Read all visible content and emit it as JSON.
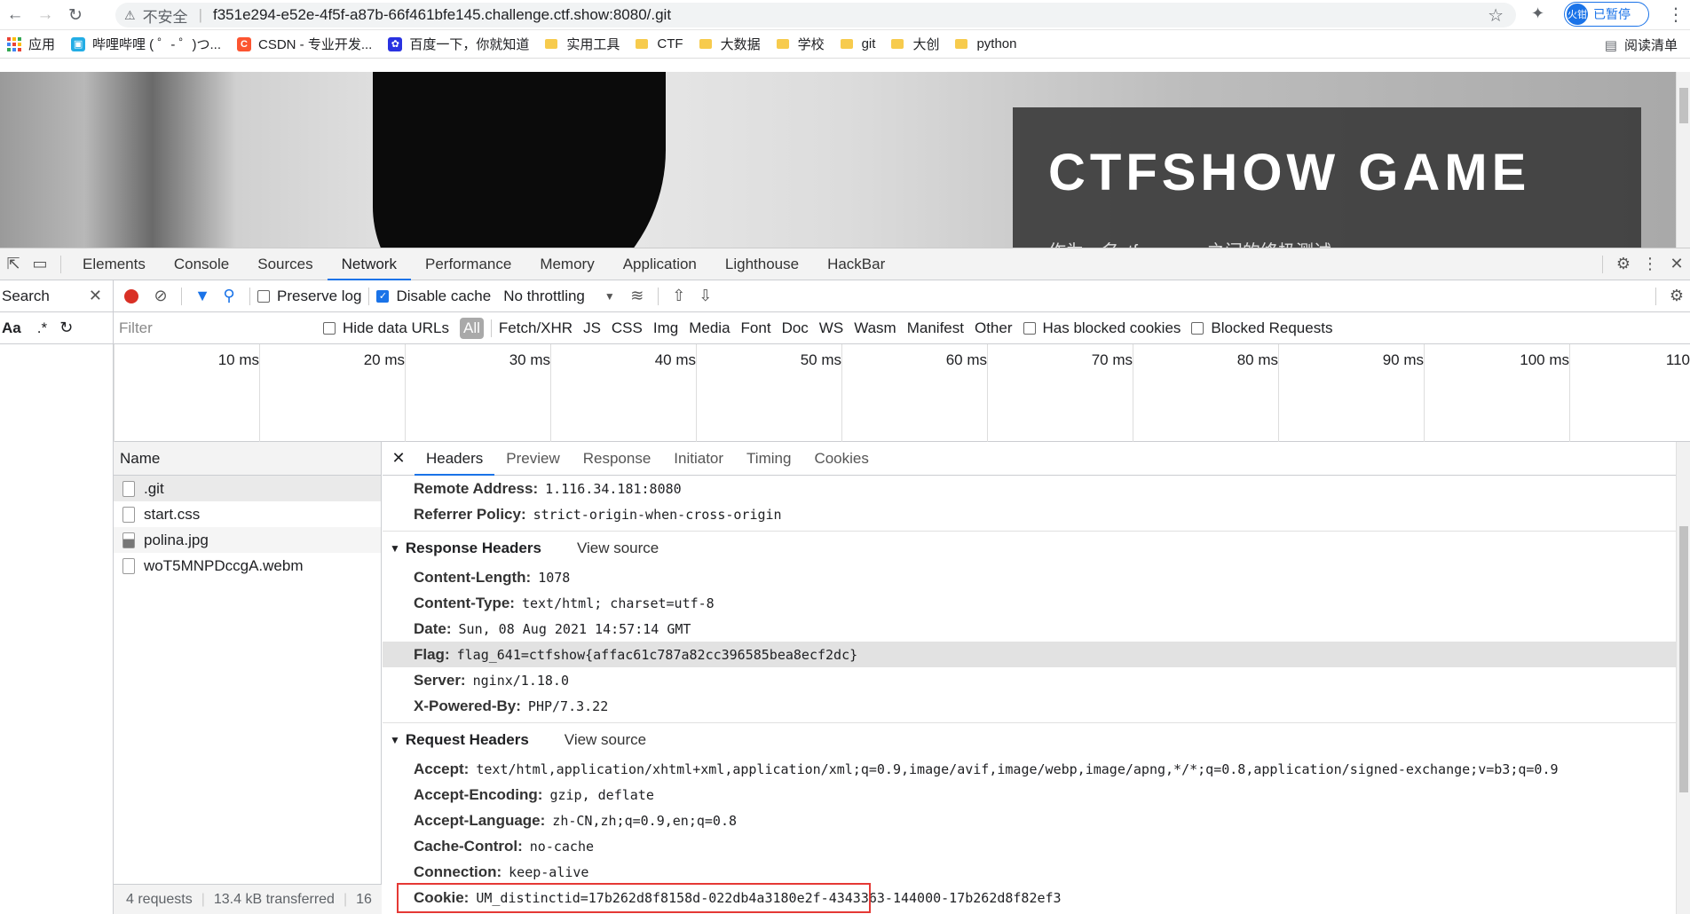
{
  "browser": {
    "security_label": "不安全",
    "url": "f351e294-e52e-4f5f-a87b-66f461bfe145.challenge.ctf.show:8080/.git",
    "profile_avatar": "火钳",
    "profile_status": "已暂停"
  },
  "bookmarks": {
    "apps": "应用",
    "items": [
      "哔哩哔哩 ( ゜- ゜)つ...",
      "CSDN - 专业开发...",
      "百度一下，你就知道",
      "实用工具",
      "CTF",
      "大数据",
      "学校",
      "git",
      "大创",
      "python"
    ],
    "reading_list": "阅读清单"
  },
  "page": {
    "title": "CTFSHOW GAME",
    "subtitle": "作为一名ctfer，……之间的终极测试"
  },
  "devtools": {
    "tabs": [
      "Elements",
      "Console",
      "Sources",
      "Network",
      "Performance",
      "Memory",
      "Application",
      "Lighthouse",
      "HackBar"
    ],
    "active_tab": "Network",
    "search_label": "Search",
    "preserve_log": "Preserve log",
    "disable_cache": "Disable cache",
    "throttling": "No throttling",
    "filter_placeholder": "Filter",
    "hide_data_urls": "Hide data URLs",
    "all_label": "All",
    "filter_types": [
      "Fetch/XHR",
      "JS",
      "CSS",
      "Img",
      "Media",
      "Font",
      "Doc",
      "WS",
      "Wasm",
      "Manifest",
      "Other"
    ],
    "has_blocked_cookies": "Has blocked cookies",
    "blocked_requests": "Blocked Requests",
    "aa_label": "Aa",
    "regex_label": ".*",
    "timeline_ticks": [
      "10 ms",
      "20 ms",
      "30 ms",
      "40 ms",
      "50 ms",
      "60 ms",
      "70 ms",
      "80 ms",
      "90 ms",
      "100 ms",
      "110"
    ],
    "name_header": "Name",
    "requests": [
      ".git",
      "start.css",
      "polina.jpg",
      "woT5MNPDccgA.webm"
    ],
    "footer": {
      "requests": "4 requests",
      "transferred": "13.4 kB transferred",
      "more": "16"
    },
    "detail_tabs": [
      "Headers",
      "Preview",
      "Response",
      "Initiator",
      "Timing",
      "Cookies"
    ],
    "general": [
      {
        "k": "Remote Address:",
        "v": "1.116.34.181:8080"
      },
      {
        "k": "Referrer Policy:",
        "v": "strict-origin-when-cross-origin"
      }
    ],
    "response_title": "Response Headers",
    "view_source": "View source",
    "response_headers": [
      {
        "k": "Content-Length:",
        "v": "1078"
      },
      {
        "k": "Content-Type:",
        "v": "text/html; charset=utf-8"
      },
      {
        "k": "Date:",
        "v": "Sun, 08 Aug 2021 14:57:14 GMT"
      },
      {
        "k": "Flag:",
        "v": "flag_641=ctfshow{affac61c787a82cc396585bea8ecf2dc}"
      },
      {
        "k": "Server:",
        "v": "nginx/1.18.0"
      },
      {
        "k": "X-Powered-By:",
        "v": "PHP/7.3.22"
      }
    ],
    "request_title": "Request Headers",
    "request_headers": [
      {
        "k": "Accept:",
        "v": "text/html,application/xhtml+xml,application/xml;q=0.9,image/avif,image/webp,image/apng,*/*;q=0.8,application/signed-exchange;v=b3;q=0.9"
      },
      {
        "k": "Accept-Encoding:",
        "v": "gzip, deflate"
      },
      {
        "k": "Accept-Language:",
        "v": "zh-CN,zh;q=0.9,en;q=0.8"
      },
      {
        "k": "Cache-Control:",
        "v": "no-cache"
      },
      {
        "k": "Connection:",
        "v": "keep-alive"
      },
      {
        "k": "Cookie:",
        "v": "UM_distinctid=17b262d8f8158d-022db4a3180e2f-4343363-144000-17b262d8f82ef3"
      }
    ],
    "colors": {
      "accent": "#1a73e8",
      "record": "#d93025",
      "highlight_box": "#e53935"
    }
  }
}
